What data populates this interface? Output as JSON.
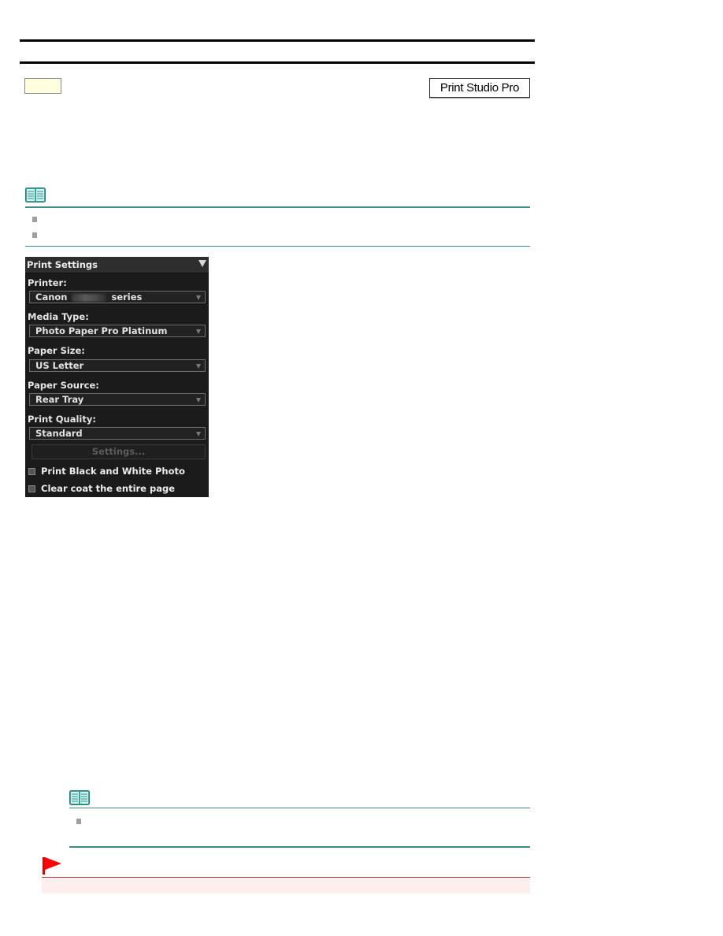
{
  "header": {
    "app_badge": "Print Studio Pro",
    "yellow_tag": ""
  },
  "note_1": {
    "icon": "note-book-icon",
    "bullets": [
      "",
      ""
    ]
  },
  "print_settings": {
    "title": "Print Settings",
    "collapse_icon": "triangle-down-icon",
    "fields": [
      {
        "label": "Printer:",
        "value_prefix": "Canon",
        "value_suffix": "series"
      },
      {
        "label": "Media Type:",
        "value": "Photo Paper Pro Platinum"
      },
      {
        "label": "Paper Size:",
        "value": "US Letter"
      },
      {
        "label": "Paper Source:",
        "value": "Rear Tray"
      },
      {
        "label": "Print Quality:",
        "value": "Standard"
      }
    ],
    "settings_button": "Settings...",
    "checkboxes": [
      {
        "label": "Print Black and White Photo",
        "checked": false
      },
      {
        "label": "Clear coat the entire page",
        "checked": false
      }
    ]
  },
  "note_2": {
    "icon": "note-book-icon",
    "bullets": [
      ""
    ]
  },
  "caution": {
    "icon": "red-flag-icon"
  },
  "colors": {
    "note_rule": "#3d8c8a",
    "caution_rule": "#b04040",
    "caution_bg": "#ffeeee",
    "panel_bg": "#1b1b1b"
  }
}
